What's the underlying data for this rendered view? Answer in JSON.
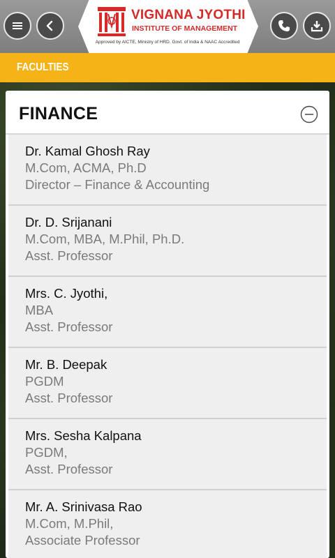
{
  "header": {
    "logo_title": "VIGNANA JYOTHI",
    "logo_subtitle": "INSTITUTE OF MANAGEMENT",
    "logo_approval": "Approved by AICTE, Ministry of HRD. Govt. of India & NAAC Accredited",
    "icons": [
      "menu-icon",
      "back-icon",
      "phone-icon",
      "download-icon"
    ]
  },
  "section": {
    "title": "FACULTIES"
  },
  "card": {
    "title": "FINANCE",
    "faculty": [
      {
        "name": "Dr. Kamal Ghosh Ray",
        "qualification": "M.Com, ACMA, Ph.D",
        "role": "Director – Finance & Accounting"
      },
      {
        "name": "Dr. D. Srijanani",
        "qualification": "M.Com, MBA, M.Phil, Ph.D.",
        "role": "Asst. Professor"
      },
      {
        "name": "Mrs. C. Jyothi,",
        "qualification": "MBA",
        "role": "Asst. Professor"
      },
      {
        "name": "Mr. B. Deepak",
        "qualification": "PGDM",
        "role": "Asst. Professor"
      },
      {
        "name": "Mrs. Sesha Kalpana",
        "qualification": "PGDM,",
        "role": "Asst. Professor"
      },
      {
        "name": "Mr. A. Srinivasa Rao",
        "qualification": "M.Com, M.Phil,",
        "role": "Associate Professor"
      }
    ]
  },
  "colors": {
    "section_bar": "#f5b318",
    "logo_red": "#d42a2a",
    "header_gray": "#8c8c8c",
    "button_dark": "#4a4a4a"
  }
}
